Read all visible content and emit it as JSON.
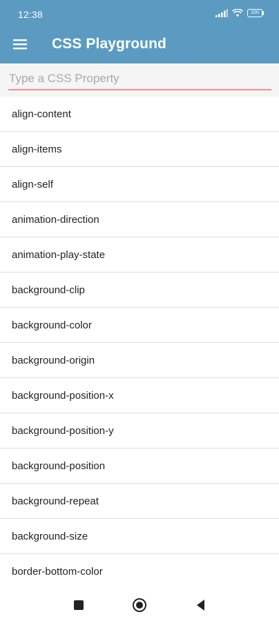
{
  "status_bar": {
    "time": "12:38",
    "battery": "100",
    "icons": [
      "signal-icon",
      "wifi-icon",
      "battery-icon"
    ]
  },
  "app_bar": {
    "title": "CSS Playground",
    "menu_icon": "hamburger-menu-icon",
    "color": "#5b9bc2"
  },
  "search": {
    "placeholder": "Type a CSS Property",
    "value": "",
    "underline_color": "#f28b95"
  },
  "properties": [
    "align-content",
    "align-items",
    "align-self",
    "animation-direction",
    "animation-play-state",
    "background-clip",
    "background-color",
    "background-origin",
    "background-position-x",
    "background-position-y",
    "background-position",
    "background-repeat",
    "background-size",
    "border-bottom-color"
  ],
  "nav_bar": {
    "buttons": [
      "recents-square-icon",
      "home-circle-icon",
      "back-triangle-icon"
    ]
  }
}
